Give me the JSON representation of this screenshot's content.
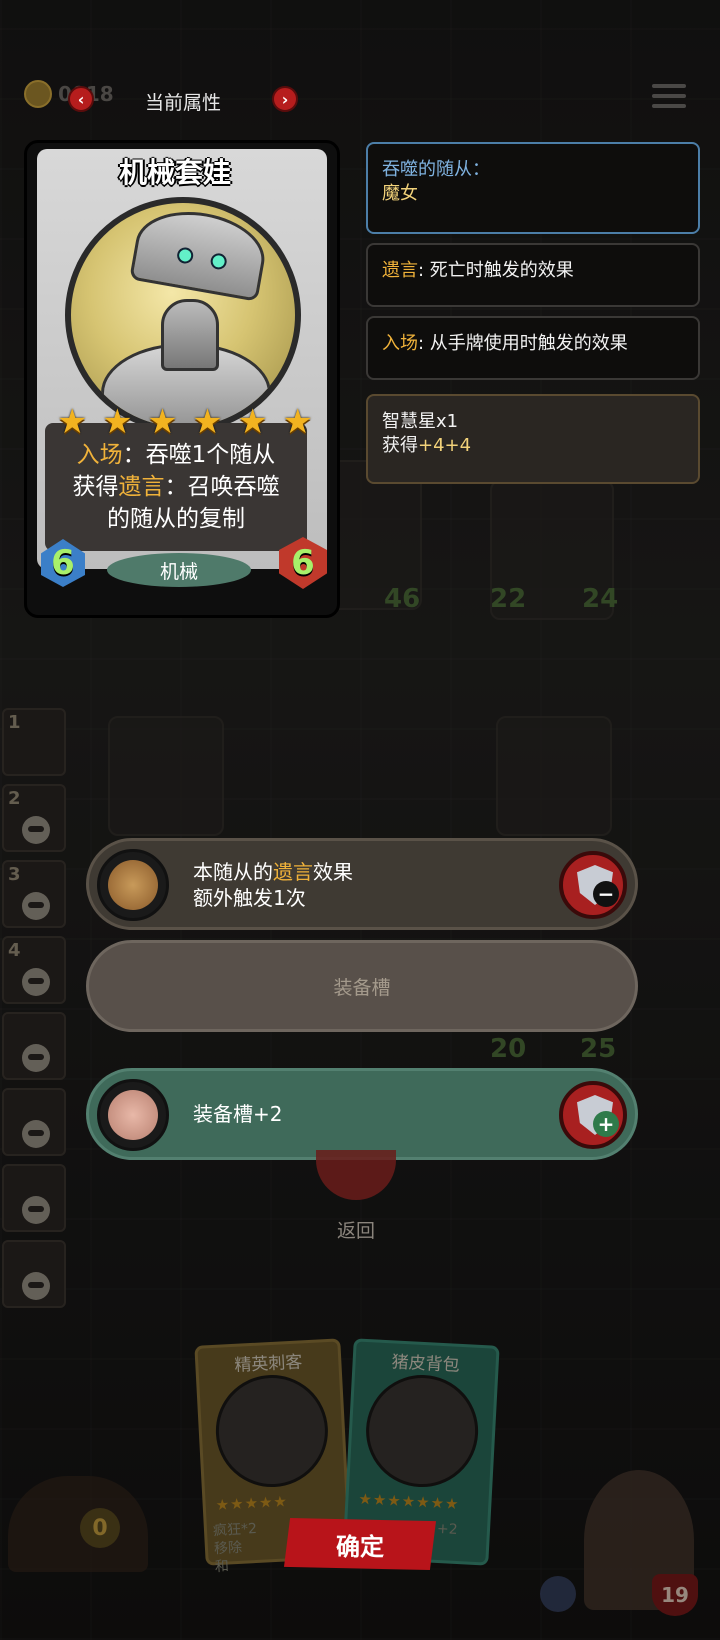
{
  "top_bar": {
    "coin_value": "0018",
    "title": "当前属性",
    "prev_icon": "chevron-left-icon",
    "next_icon": "chevron-right-icon",
    "menu_icon": "hamburger-menu-icon"
  },
  "card": {
    "name": "机械套娃",
    "stars": 6,
    "desc_line1_kw": "入场",
    "desc_line1_rest": "：吞噬1个随从",
    "desc_line2_pre": "获得",
    "desc_line2_kw": "遗言",
    "desc_line2_rest": "：召唤吞噬",
    "desc_line3": "的随从的复制",
    "attack": "6",
    "health": "6",
    "tribe": "机械"
  },
  "keyword_panels": {
    "devoured_label": "吞噬的随从：",
    "devoured_value": "魔女",
    "deathrattle_kw": "遗言",
    "deathrattle_desc": ": 死亡时触发的效果",
    "battlecry_kw": "入场",
    "battlecry_desc": ": 从手牌使用时触发的效果",
    "wisdom_title": "智慧星x1",
    "wisdom_gain_pre": "获得",
    "wisdom_gain_value": "+4+4"
  },
  "board_numbers": [
    "46",
    "22",
    "24",
    "20",
    "25"
  ],
  "tavern_slots": [
    "1",
    "2",
    "3",
    "4",
    "",
    "",
    "",
    ""
  ],
  "equipment": {
    "row1_line1_pre": "本随从的",
    "row1_line1_kw": "遗言",
    "row1_line1_post": "效果",
    "row1_line2": "额外触发1次",
    "row1_icon": "skull-coin-icon",
    "row1_button_icon": "shield-minus-icon",
    "row2_label": "装备槽",
    "row3_label": "装备槽+2",
    "row3_icon": "pig-backpack-icon",
    "row3_button_icon": "shield-plus-icon"
  },
  "back_label": "返回",
  "shop": {
    "card1_title": "精英刺客",
    "card1_stars": "★★★★★",
    "card1_desc": "疯狂*2\n移除\n和",
    "card2_title": "猪皮背包",
    "card2_stars": "★★★★★★★",
    "card2_desc": "+2"
  },
  "confirm_label": "确定",
  "bottom": {
    "gold": "0",
    "hero_hp": "19"
  },
  "colors": {
    "keyword_gold": "#f0b23a",
    "keyword_blue": "#7fb2e0",
    "confirm_red": "#b8141a",
    "star_gold": "#f2b320",
    "stat_green": "#a8f06a"
  }
}
